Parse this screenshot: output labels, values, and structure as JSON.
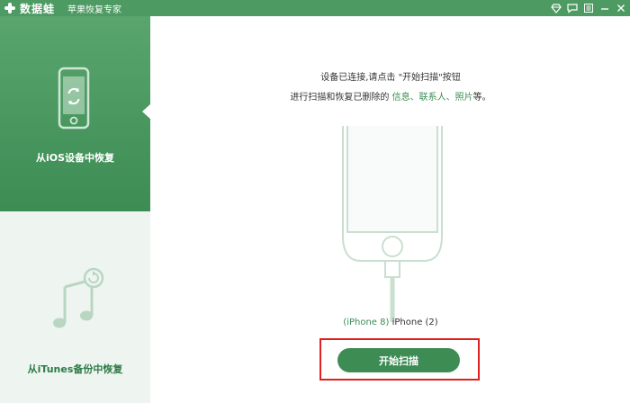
{
  "app": {
    "name": "数据蛙",
    "subtitle": "苹果恢复专家"
  },
  "window_controls": [
    {
      "name": "diamond-icon",
      "label": "♦"
    },
    {
      "name": "chat-icon",
      "label": "💬"
    },
    {
      "name": "menu-icon",
      "label": "≡"
    },
    {
      "name": "minimize-icon",
      "label": "—"
    },
    {
      "name": "close-icon",
      "label": "✕"
    }
  ],
  "sidebar": {
    "items": [
      {
        "label": "从iOS设备中恢复",
        "icon": "phone-restore-icon",
        "active": true
      },
      {
        "label": "从iTunes备份中恢复",
        "icon": "itunes-music-icon",
        "active": false
      }
    ]
  },
  "main": {
    "line1": "设备已连接,请点击 \"开始扫描\"按钮",
    "line2_prefix": "进行扫描和恢复已删除的 ",
    "line2_highlight": "信息、联系人、照片",
    "line2_suffix": "等。",
    "device_model": "(iPhone 8)",
    "device_name": "iPhone (2)",
    "scan_button": "开始扫描"
  },
  "colors": {
    "brand": "#4d9a62",
    "accent": "#3c8c54",
    "highlight_frame": "#e02020",
    "sidebar_inactive_bg": "#eef5f0"
  }
}
